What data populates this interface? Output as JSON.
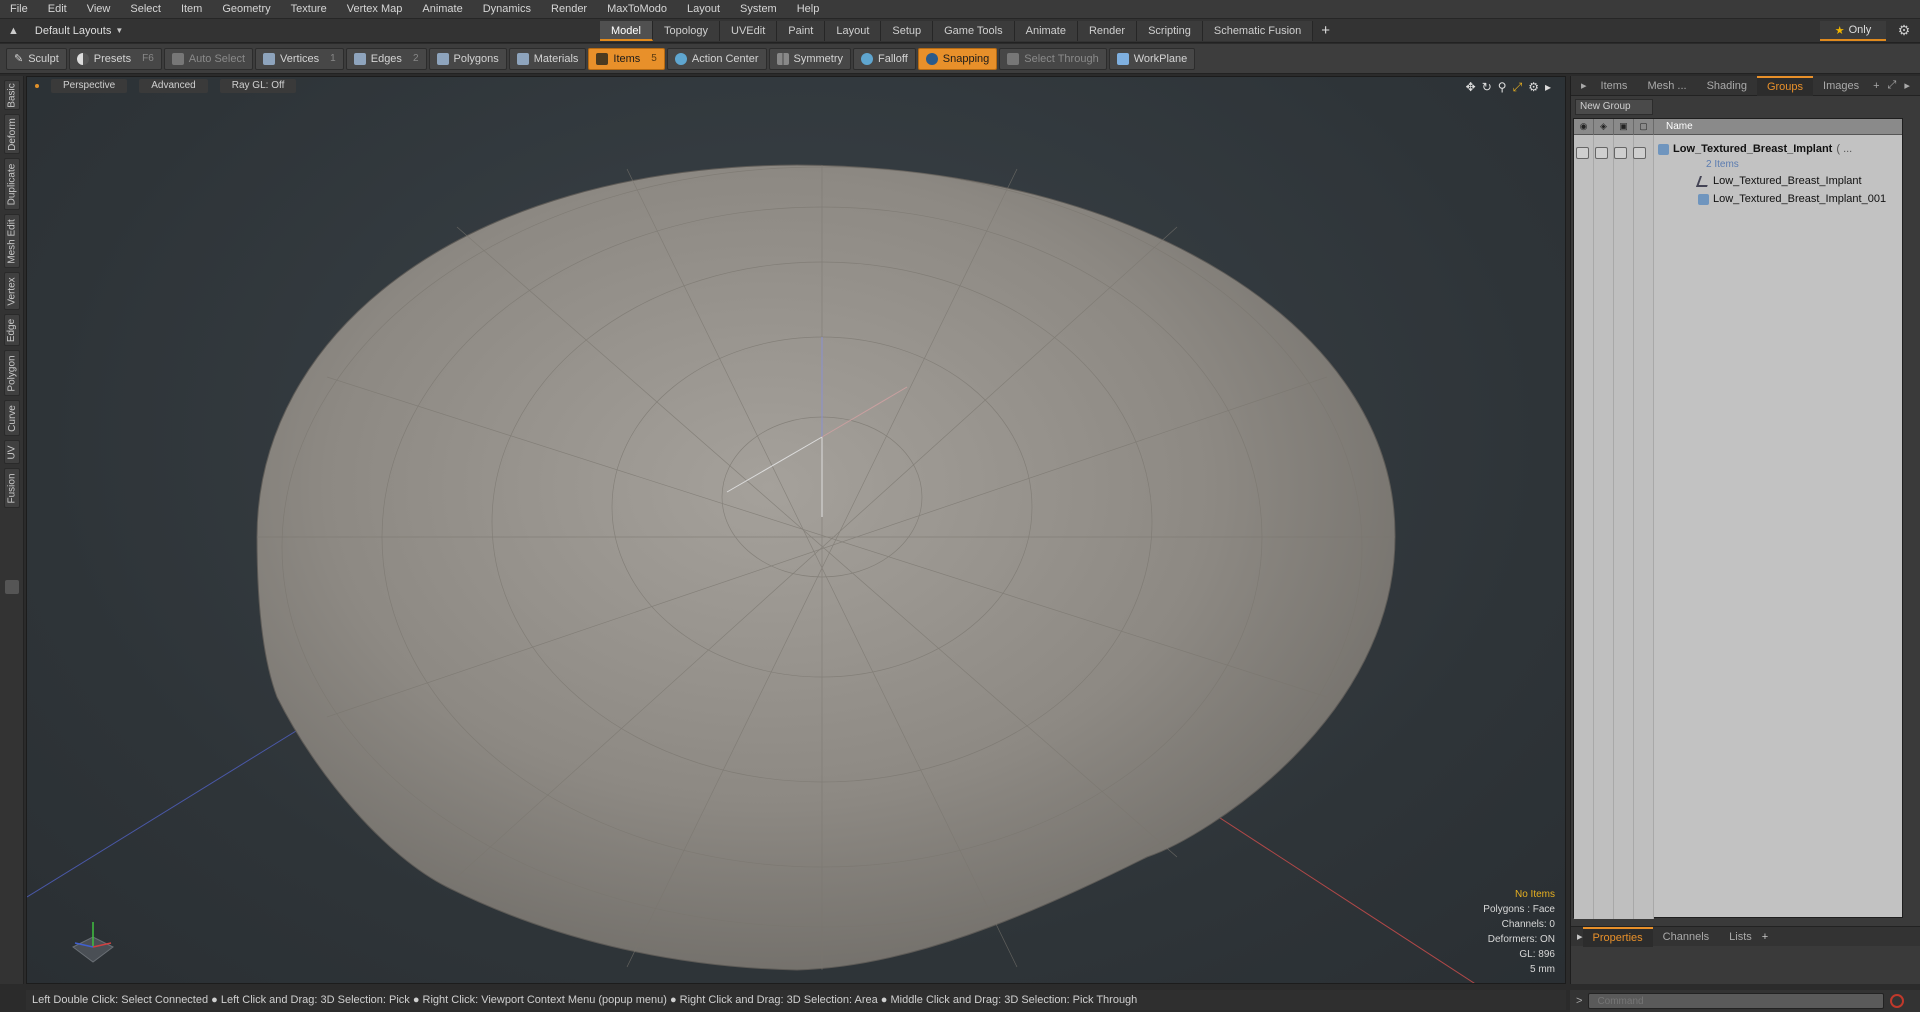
{
  "menu": [
    "File",
    "Edit",
    "View",
    "Select",
    "Item",
    "Geometry",
    "Texture",
    "Vertex Map",
    "Animate",
    "Dynamics",
    "Render",
    "MaxToModo",
    "Layout",
    "System",
    "Help"
  ],
  "layout_selector": "Default Layouts",
  "mode_tabs": [
    "Model",
    "Topology",
    "UVEdit",
    "Paint",
    "Layout",
    "Setup",
    "Game Tools",
    "Animate",
    "Render",
    "Scripting",
    "Schematic Fusion"
  ],
  "active_mode_tab": "Model",
  "only_label": "Only",
  "toolbar": {
    "sculpt": "Sculpt",
    "presets": "Presets",
    "presets_key": "F6",
    "auto_select": "Auto Select",
    "vertices": "Vertices",
    "vertices_count": "1",
    "edges": "Edges",
    "edges_count": "2",
    "polygons": "Polygons",
    "materials": "Materials",
    "items": "Items",
    "items_count": "5",
    "action_center": "Action Center",
    "symmetry": "Symmetry",
    "falloff": "Falloff",
    "snapping": "Snapping",
    "select_through": "Select Through",
    "workplane": "WorkPlane"
  },
  "left_tabs": [
    "Basic",
    "Deform",
    "Duplicate",
    "Mesh Edit",
    "Vertex",
    "Edge",
    "Polygon",
    "Curve",
    "UV",
    "Fusion"
  ],
  "viewport": {
    "view_label": "Perspective",
    "shading_label": "Advanced",
    "raygl_label": "Ray GL: Off",
    "stats": {
      "selection": "No Items",
      "polygons": "Polygons : Face",
      "channels": "Channels: 0",
      "deformers": "Deformers: ON",
      "gl": "GL: 896",
      "unit": "5 mm"
    }
  },
  "right_panel": {
    "tabs": [
      "Items",
      "Mesh ...",
      "Shading",
      "Groups",
      "Images"
    ],
    "active_tab": "Groups",
    "new_group": "New Group",
    "column_name": "Name",
    "group_name": "Low_Textured_Breast_Implant",
    "group_suffix": "( ...",
    "group_count": "2 Items",
    "children": [
      "Low_Textured_Breast_Implant",
      "Low_Textured_Breast_Implant_001"
    ],
    "bottom_tabs": [
      "Properties",
      "Channels",
      "Lists"
    ],
    "active_bottom_tab": "Properties"
  },
  "status_bar": "Left Double Click: Select Connected ● Left Click and Drag: 3D Selection: Pick ● Right Click: Viewport Context Menu (popup menu) ● Right Click and Drag: 3D Selection: Area ● Middle Click and Drag: 3D Selection: Pick Through",
  "command_placeholder": "Command",
  "colors": {
    "accent": "#e8902a",
    "mesh": "#8a8680",
    "viewport_bg": "#2e3438"
  }
}
